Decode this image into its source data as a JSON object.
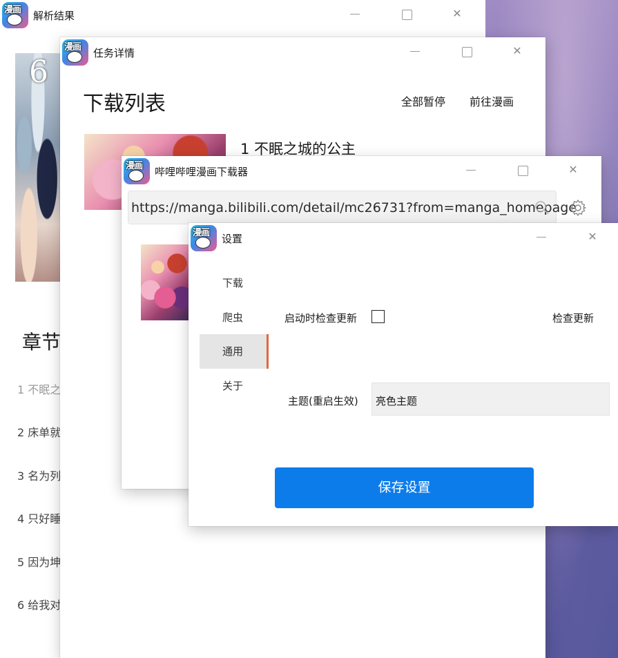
{
  "windows": {
    "parse_result": {
      "title": "解析结果",
      "chapters_heading": "章节",
      "chapters": [
        "1 不眠之",
        "2 床单就",
        "3 名为列",
        "4 只好睡",
        "5 因为坤",
        "6 给我对"
      ]
    },
    "task_detail": {
      "title": "任务详情",
      "heading": "下载列表",
      "pause_all_label": "全部暂停",
      "goto_manga_label": "前往漫画",
      "task_title": "1 不眠之城的公主"
    },
    "downloader": {
      "title": "哔哩哔哩漫画下载器",
      "url": "https://manga.bilibili.com/detail/mc26731?from=manga_homepage"
    },
    "settings": {
      "title": "设置",
      "nav": [
        "下载",
        "爬虫",
        "通用",
        "关于"
      ],
      "active_nav": "通用",
      "check_update_on_start_label": "启动时检查更新",
      "check_update_on_start": false,
      "check_update_button": "检查更新",
      "theme_label": "主题(重启生效)",
      "theme_value": "亮色主题",
      "save_button": "保存设置"
    }
  },
  "app_icon_text": "漫画",
  "icons": {
    "minimize": "minimize-icon",
    "maximize": "maximize-icon",
    "close": "close-icon",
    "search": "search-icon",
    "settings": "gear-icon"
  },
  "colors": {
    "accent_button": "#0d7ceb",
    "active_nav_indicator": "#e4663c",
    "active_nav_background": "#e5e5e5"
  }
}
